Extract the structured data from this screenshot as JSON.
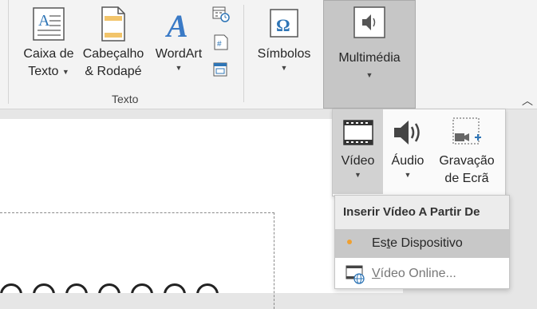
{
  "ribbon": {
    "text_box": {
      "line1": "Caixa de",
      "line2": "Texto",
      "icon": "text-box-icon"
    },
    "header_footer": {
      "line1": "Cabeçalho",
      "line2": "& Rodapé",
      "icon": "header-footer-icon"
    },
    "wordart": {
      "label": "WordArt",
      "icon": "wordart-icon"
    },
    "small_icons": [
      "date-time-icon",
      "slide-number-icon",
      "object-icon"
    ],
    "group_label": "Texto",
    "symbols": {
      "label": "Símbolos",
      "icon": "omega-icon"
    },
    "multimedia": {
      "label": "Multimédia",
      "icon": "speaker-icon"
    },
    "collapse_icon": "chevron-up-icon"
  },
  "multimedia_panel": {
    "video": {
      "label": "Vídeo",
      "icon": "film-icon"
    },
    "audio": {
      "label": "Áudio",
      "icon": "speaker-icon"
    },
    "screen_recording": {
      "line1": "Gravação",
      "line2": "de Ecrã",
      "icon": "screen-recording-icon"
    }
  },
  "video_menu": {
    "header": "Inserir Vídeo A Partir De",
    "items": [
      {
        "pre": "Es",
        "underlined": "t",
        "post": "e Dispositivo",
        "icon": "bullet-icon",
        "highlighted": true
      },
      {
        "pre": "",
        "underlined": "V",
        "post": "ídeo Online...",
        "icon": "online-video-icon",
        "highlighted": false
      }
    ]
  },
  "colors": {
    "ribbon_bg": "#f3f3f3",
    "accent_blue": "#2e75b6",
    "bullet_orange": "#f0a030",
    "selected_bg": "#c6c6c6"
  }
}
